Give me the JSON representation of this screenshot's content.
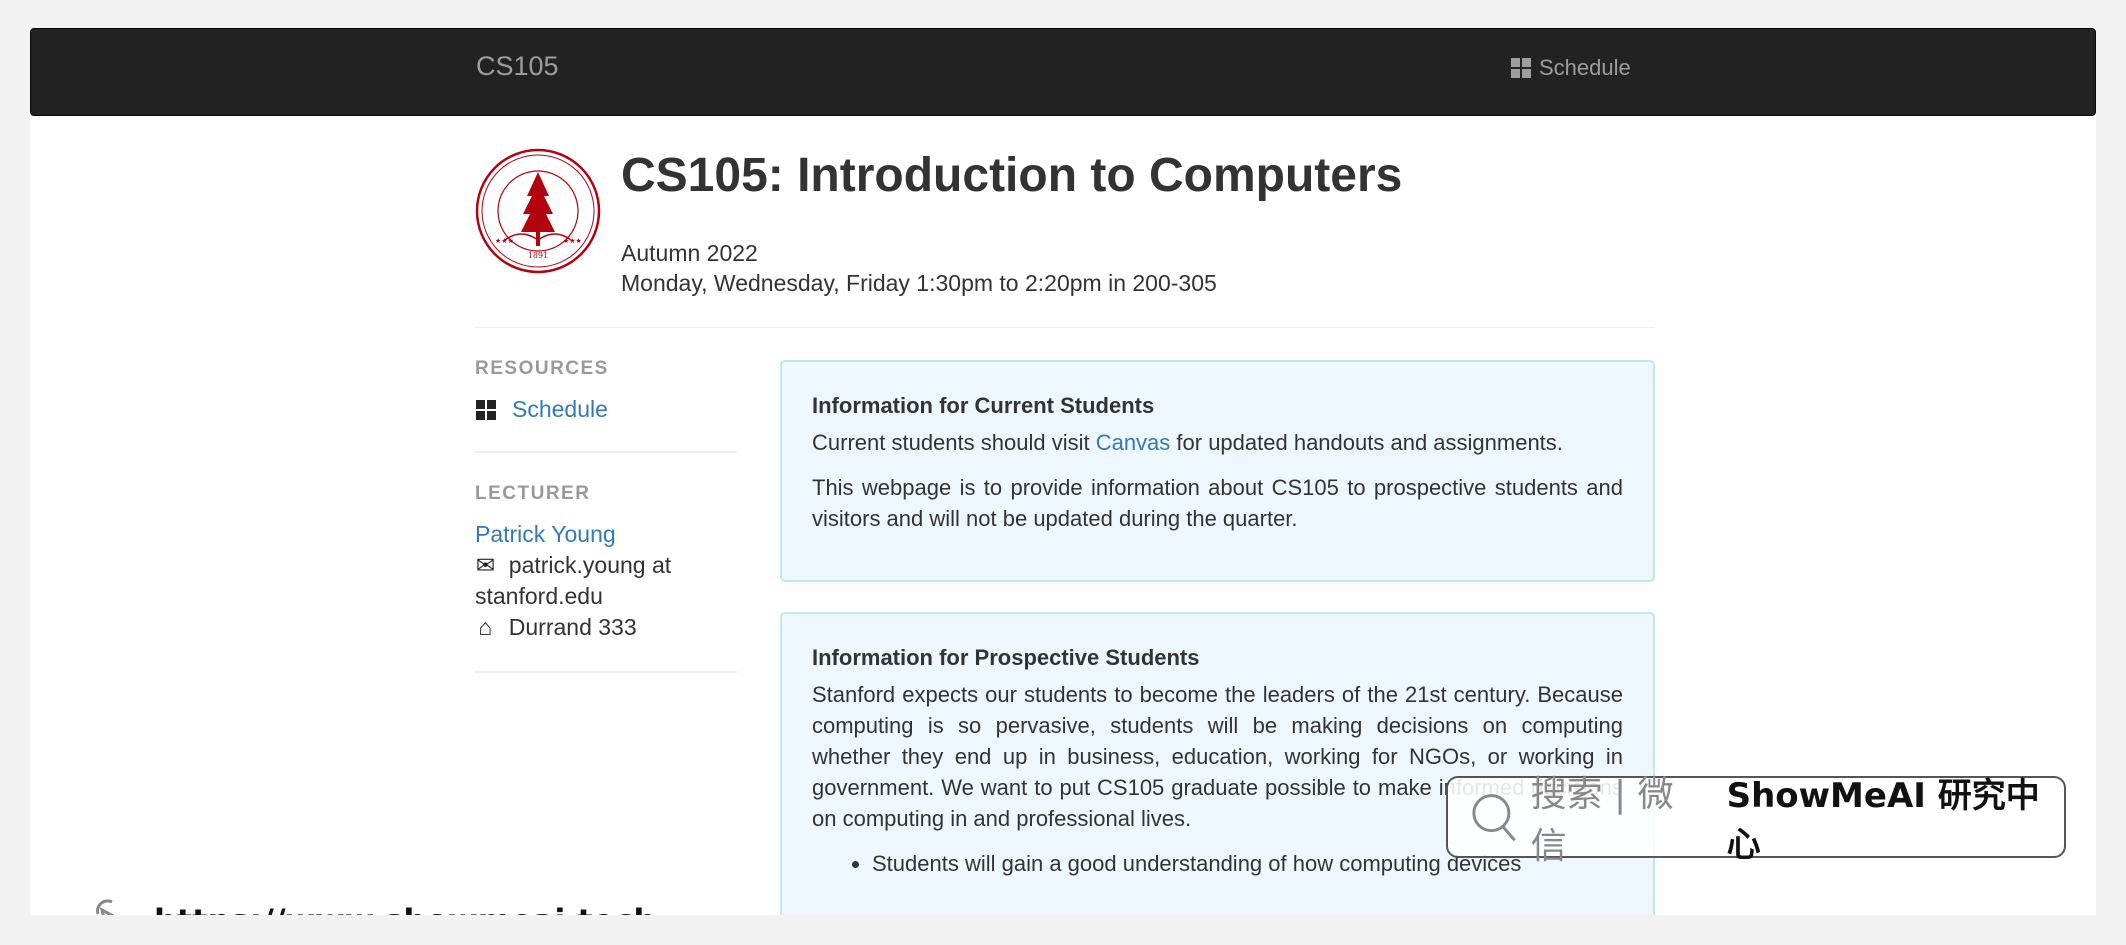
{
  "navbar": {
    "brand": "CS105",
    "links": [
      {
        "label": "Schedule",
        "icon": "th-large-icon"
      }
    ]
  },
  "header": {
    "logo": "stanford-seal",
    "title": "CS105: Introduction to Computers",
    "term": "Autumn 2022",
    "schedule": "Monday, Wednesday, Friday 1:30pm to 2:20pm in 200-305"
  },
  "sidebar": {
    "resources_heading": "RESOURCES",
    "resources": [
      {
        "label": "Schedule",
        "icon": "th-large-icon"
      }
    ],
    "lecturer_heading": "LECTURER",
    "lecturer": {
      "name": "Patrick Young",
      "email": "patrick.young at stanford.edu",
      "email_icon": "envelope-icon",
      "office": "Durrand 333",
      "office_icon": "home-icon"
    }
  },
  "panels": {
    "current": {
      "heading": "Information for Current Students",
      "p1_before": "Current students should visit ",
      "p1_link": "Canvas",
      "p1_after": " for updated handouts and assignments.",
      "p2": "This webpage is to provide information about CS105 to prospective students and visitors and will not be updated during the quarter."
    },
    "prospective": {
      "heading": "Information for Prospective Students",
      "p1": "Stanford expects our students to become the leaders of the 21st century. Because computing is so pervasive, students will be making decisions on computing whether they end up in business, education, working for NGOs, or working in government. We want to put CS105 graduate possible to make informed decisions on computing in and professional lives.",
      "bullets": [
        "Students will gain a good understanding of how computing devices"
      ]
    }
  },
  "watermark": {
    "search_text": "搜索 | 微信",
    "brand_text": "ShowMeAI 研究中心",
    "url": "https://www.showmeai.tech"
  },
  "colors": {
    "navbar_bg": "#222222",
    "link": "#337ab7",
    "panel_bg": "#eff7fe",
    "panel_border": "#bce8f1",
    "seal_red": "#b1040e"
  }
}
